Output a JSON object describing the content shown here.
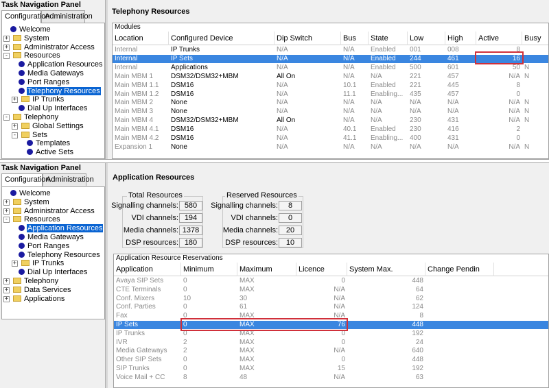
{
  "top": {
    "nav_title": "Task Navigation Panel",
    "tabs": [
      "Configuration",
      "Administration"
    ],
    "tree": [
      {
        "label": "Welcome",
        "icon": "dot"
      },
      {
        "label": "System",
        "icon": "folder",
        "exp": "+"
      },
      {
        "label": "Administrator Access",
        "icon": "folder",
        "exp": "+"
      },
      {
        "label": "Resources",
        "icon": "folder",
        "exp": "-"
      },
      {
        "label": "Application Resources",
        "icon": "dot"
      },
      {
        "label": "Media Gateways",
        "icon": "dot"
      },
      {
        "label": "Port Ranges",
        "icon": "dot"
      },
      {
        "label": "Telephony Resources",
        "icon": "dot",
        "selected": true
      },
      {
        "label": "IP Trunks",
        "icon": "folder",
        "exp": "+"
      },
      {
        "label": "Dial Up Interfaces",
        "icon": "dot"
      },
      {
        "label": "Telephony",
        "icon": "folder",
        "exp": "-"
      },
      {
        "label": "Global Settings",
        "icon": "folder",
        "exp": "+"
      },
      {
        "label": "Sets",
        "icon": "folder",
        "exp": "-"
      },
      {
        "label": "Templates",
        "icon": "dot"
      },
      {
        "label": "Active Sets",
        "icon": "dot"
      }
    ],
    "heading": "Telephony Resources",
    "grid_title": "Modules",
    "columns": [
      "Location",
      "Configured Device",
      "Dip Switch",
      "Bus",
      "State",
      "Low",
      "High",
      "Active",
      "Busy"
    ],
    "rows": [
      [
        "Internal",
        "IP Trunks",
        "N/A",
        "N/A",
        "Enabled",
        "001",
        "008",
        "8",
        ""
      ],
      [
        "Internal",
        "IP Sets",
        "N/A",
        "N/A",
        "Enabled",
        "244",
        "461",
        "16",
        ""
      ],
      [
        "Internal",
        "Applications",
        "N/A",
        "N/A",
        "Enabled",
        "500",
        "601",
        "50",
        "N"
      ],
      [
        "Main MBM  1",
        "DSM32/DSM32+MBM",
        "All On",
        "N/A",
        "N/A",
        "221",
        "457",
        "N/A",
        "N"
      ],
      [
        "Main MBM  1.1",
        "DSM16",
        "N/A",
        "10.1",
        "Enabled",
        "221",
        "445",
        "8",
        ""
      ],
      [
        "Main MBM  1.2",
        "DSM16",
        "N/A",
        "11.1",
        "Enabling...",
        "435",
        "457",
        "0",
        ""
      ],
      [
        "Main MBM  2",
        "None",
        "N/A",
        "N/A",
        "N/A",
        "N/A",
        "N/A",
        "N/A",
        "N"
      ],
      [
        "Main MBM  3",
        "None",
        "N/A",
        "N/A",
        "N/A",
        "N/A",
        "N/A",
        "N/A",
        "N"
      ],
      [
        "Main MBM  4",
        "DSM32/DSM32+MBM",
        "All On",
        "N/A",
        "N/A",
        "230",
        "431",
        "N/A",
        "N"
      ],
      [
        "Main MBM  4.1",
        "DSM16",
        "N/A",
        "40.1",
        "Enabled",
        "230",
        "416",
        "2",
        ""
      ],
      [
        "Main MBM  4.2",
        "DSM16",
        "N/A",
        "41.1",
        "Enabling...",
        "400",
        "431",
        "0",
        ""
      ],
      [
        "Expansion  1",
        "None",
        "N/A",
        "N/A",
        "N/A",
        "N/A",
        "N/A",
        "N/A",
        "N"
      ]
    ],
    "selected_row": 1
  },
  "bottom": {
    "nav_title": "Task Navigation Panel",
    "tabs": [
      "Configuration",
      "Administration"
    ],
    "tree": [
      {
        "label": "Welcome",
        "icon": "dot"
      },
      {
        "label": "System",
        "icon": "folder",
        "exp": "+"
      },
      {
        "label": "Administrator Access",
        "icon": "folder",
        "exp": "+"
      },
      {
        "label": "Resources",
        "icon": "folder",
        "exp": "-"
      },
      {
        "label": "Application Resources",
        "icon": "dot",
        "selected": true
      },
      {
        "label": "Media Gateways",
        "icon": "dot"
      },
      {
        "label": "Port Ranges",
        "icon": "dot"
      },
      {
        "label": "Telephony Resources",
        "icon": "dot"
      },
      {
        "label": "IP Trunks",
        "icon": "folder",
        "exp": "+"
      },
      {
        "label": "Dial Up Interfaces",
        "icon": "dot"
      },
      {
        "label": "Telephony",
        "icon": "folder",
        "exp": "+"
      },
      {
        "label": "Data Services",
        "icon": "folder",
        "exp": "+"
      },
      {
        "label": "Applications",
        "icon": "folder",
        "exp": "+"
      }
    ],
    "heading": "Application Resources",
    "total": {
      "title": "Total Resources",
      "fields": [
        {
          "label": "Signalling channels:",
          "value": "580"
        },
        {
          "label": "VDI channels:",
          "value": "194"
        },
        {
          "label": "Media channels:",
          "value": "1378"
        },
        {
          "label": "DSP resources:",
          "value": "180"
        }
      ]
    },
    "reserved": {
      "title": "Reserved Resources",
      "fields": [
        {
          "label": "Signalling channels:",
          "value": "8"
        },
        {
          "label": "VDI channels:",
          "value": "0"
        },
        {
          "label": "Media channels:",
          "value": "20"
        },
        {
          "label": "DSP resources:",
          "value": "10"
        }
      ]
    },
    "grid_title": "Application Resource Reservations",
    "columns": [
      "Application",
      "Minimum",
      "Maximum",
      "Licence",
      "System Max.",
      "Change Pendin"
    ],
    "rows": [
      [
        "Avaya SIP Sets",
        "0",
        "MAX",
        "0",
        "448"
      ],
      [
        "CTE Terminals",
        "0",
        "MAX",
        "N/A",
        "64"
      ],
      [
        "Conf. Mixers",
        "10",
        "30",
        "N/A",
        "62"
      ],
      [
        "Conf. Parties",
        "0",
        "61",
        "N/A",
        "124"
      ],
      [
        "Fax",
        "0",
        "MAX",
        "N/A",
        "8"
      ],
      [
        "IP Sets",
        "0",
        "MAX",
        "76",
        "448"
      ],
      [
        "IP Trunks",
        "0",
        "MAX",
        "0",
        "192"
      ],
      [
        "IVR",
        "2",
        "MAX",
        "0",
        "24"
      ],
      [
        "Media Gateways",
        "2",
        "MAX",
        "N/A",
        "640"
      ],
      [
        "Other SIP Sets",
        "0",
        "MAX",
        "0",
        "448"
      ],
      [
        "SIP Trunks",
        "0",
        "MAX",
        "15",
        "192"
      ],
      [
        "Voice Mail + CC",
        "8",
        "48",
        "N/A",
        "63"
      ]
    ],
    "selected_row": 5
  }
}
